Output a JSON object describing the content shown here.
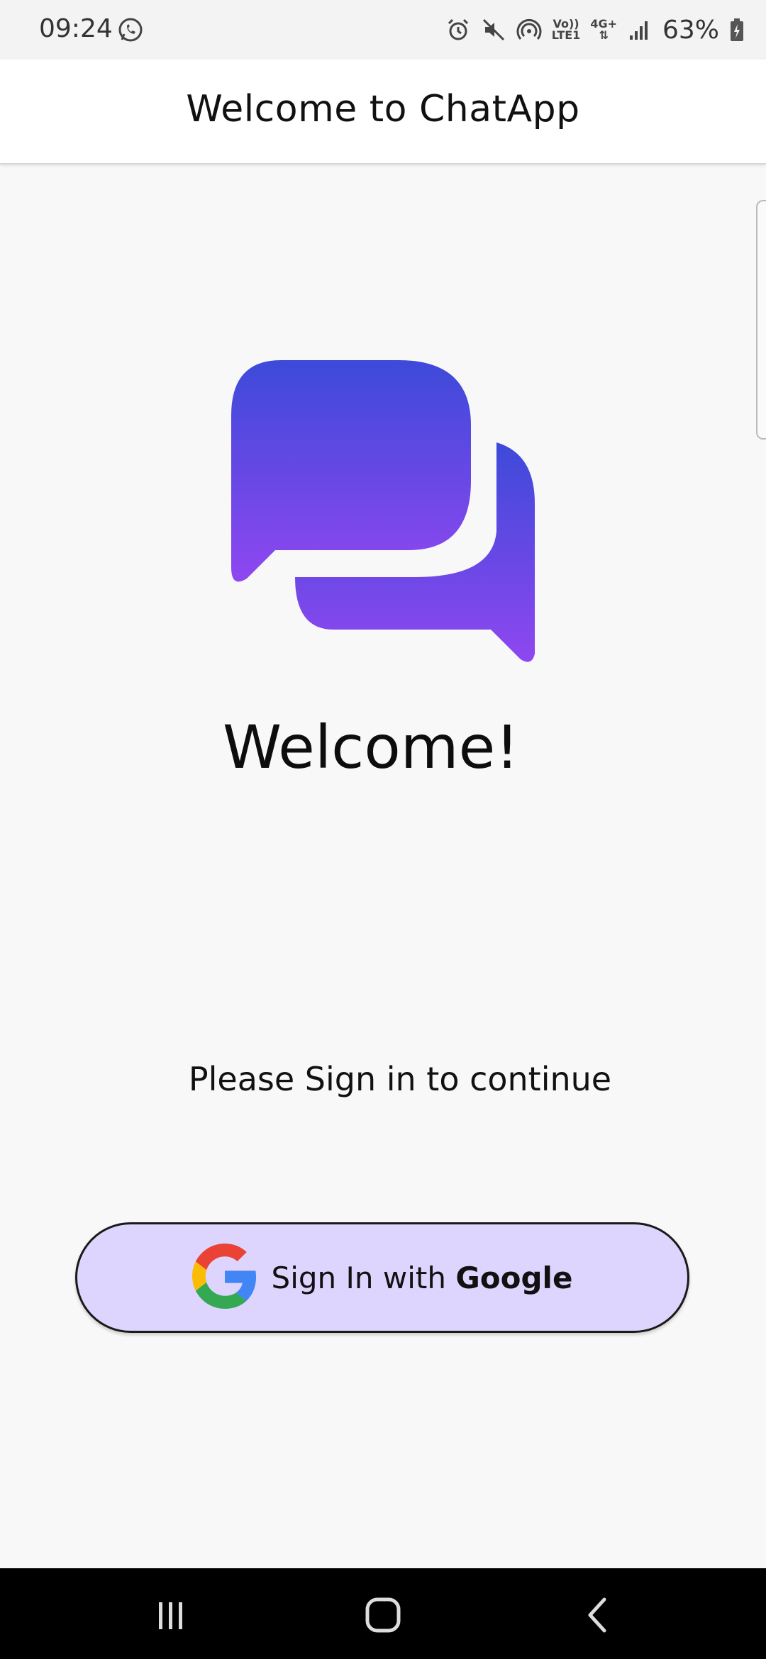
{
  "status_bar": {
    "time": "09:24",
    "network_top": "Vo))",
    "network_bottom": "LTE1",
    "network_gen": "4G+",
    "battery": "63%"
  },
  "app_bar": {
    "title": "Welcome to ChatApp"
  },
  "main": {
    "logo_icon": "chat-bubbles-icon",
    "heading": "Welcome!",
    "subtitle": "Please Sign in to continue",
    "sign_in_button": {
      "label_prefix": "Sign In with ",
      "label_brand": "Google",
      "icon": "google-g-icon",
      "background": "#ddd5fd"
    }
  },
  "navigation": {
    "recent_icon": "recent-apps-icon",
    "home_icon": "home-icon",
    "back_icon": "back-icon"
  },
  "colors": {
    "logo_gradient_top": "#3d4ad9",
    "logo_gradient_bottom": "#8f47f0",
    "google_blue": "#4285F4",
    "google_red": "#EA4335",
    "google_yellow": "#FBBC05",
    "google_green": "#34A853"
  }
}
